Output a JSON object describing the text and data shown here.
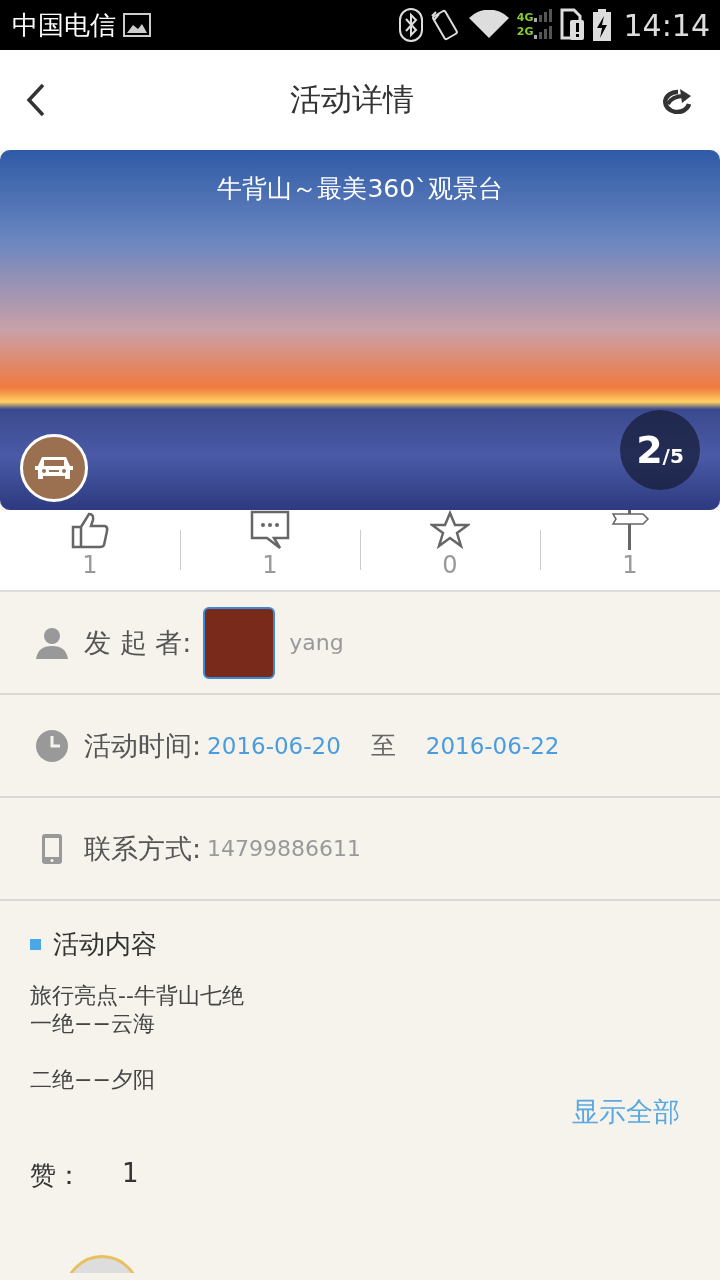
{
  "status_bar": {
    "carrier": "中国电信",
    "network_types": [
      "4G",
      "2G"
    ],
    "time": "14:14"
  },
  "header": {
    "title": "活动详情"
  },
  "banner": {
    "title": "牛背山～最美360`观景台",
    "counter_current": "2",
    "counter_total": "/5"
  },
  "stats": [
    {
      "kind": "like",
      "count": "1"
    },
    {
      "kind": "comment",
      "count": "1"
    },
    {
      "kind": "favorite",
      "count": "0"
    },
    {
      "kind": "signpost",
      "count": "1"
    }
  ],
  "organizer": {
    "label": "发 起 者:",
    "name": "yang"
  },
  "time": {
    "label": "活动时间:",
    "start": "2016-06-20",
    "separator": "至",
    "end": "2016-06-22"
  },
  "contact": {
    "label": "联系方式:",
    "phone": "14799886611"
  },
  "content": {
    "heading": "活动内容",
    "paragraphs": [
      [
        "旅行亮点--牛背山七绝",
        "一绝−−云海"
      ],
      [
        "二绝−−夕阳"
      ]
    ],
    "show_all": "显示全部"
  },
  "likes": {
    "label": "赞：",
    "count": "1"
  }
}
